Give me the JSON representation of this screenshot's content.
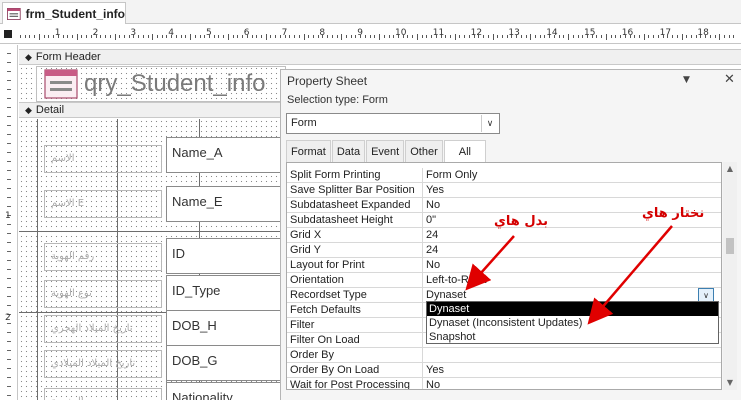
{
  "document_tab": {
    "title": "frm_Student_info",
    "icon": "form-icon"
  },
  "ruler": {
    "numbers": [
      "1",
      "2",
      "3",
      "4",
      "5",
      "6",
      "7",
      "8",
      "9",
      "10",
      "11",
      "12",
      "13",
      "14",
      "15",
      "16",
      "17",
      "18"
    ],
    "vertical_numbers": [
      "1",
      "2"
    ]
  },
  "sections": {
    "form_header": "Form Header",
    "detail": "Detail"
  },
  "form_header": {
    "title": "qry_Student_info"
  },
  "detail": {
    "labels": [
      "الاسم",
      "الاسم E",
      "رقم الهوية",
      "نوع الهوية",
      "تاريخ الميلاد الهجري",
      "تاريخ الميلاد الميلادي",
      "الجنسية"
    ],
    "fields": [
      "Name_A",
      "Name_E",
      "ID",
      "ID_Type",
      "DOB_H",
      "DOB_G",
      "Nationality"
    ]
  },
  "property_sheet": {
    "title": "Property Sheet",
    "selection_type": "Selection type:  Form",
    "selector_value": "Form",
    "tabs": [
      "Format",
      "Data",
      "Event",
      "Other",
      "All"
    ],
    "active_tab": "All",
    "rows": [
      {
        "name": "Split Form Printing",
        "value": "Form Only"
      },
      {
        "name": "Save Splitter Bar Position",
        "value": "Yes"
      },
      {
        "name": "Subdatasheet Expanded",
        "value": "No"
      },
      {
        "name": "Subdatasheet Height",
        "value": "0\""
      },
      {
        "name": "Grid X",
        "value": "24"
      },
      {
        "name": "Grid Y",
        "value": "24"
      },
      {
        "name": "Layout for Print",
        "value": "No"
      },
      {
        "name": "Orientation",
        "value": "Left-to-Right"
      },
      {
        "name": "Recordset Type",
        "value": "Dynaset"
      },
      {
        "name": "Fetch Defaults",
        "value": ""
      },
      {
        "name": "Filter",
        "value": ""
      },
      {
        "name": "Filter On Load",
        "value": ""
      },
      {
        "name": "Order By",
        "value": ""
      },
      {
        "name": "Order By On Load",
        "value": "Yes"
      },
      {
        "name": "Wait for Post Processing",
        "value": "No"
      }
    ],
    "dropdown_options": [
      "Dynaset",
      "Dynaset (Inconsistent Updates)",
      "Snapshot"
    ],
    "selected_option": "Dynaset"
  },
  "annotations": {
    "change_label": "بدل هاي",
    "choose_label": "نختار هاي",
    "color": "#d40000"
  }
}
